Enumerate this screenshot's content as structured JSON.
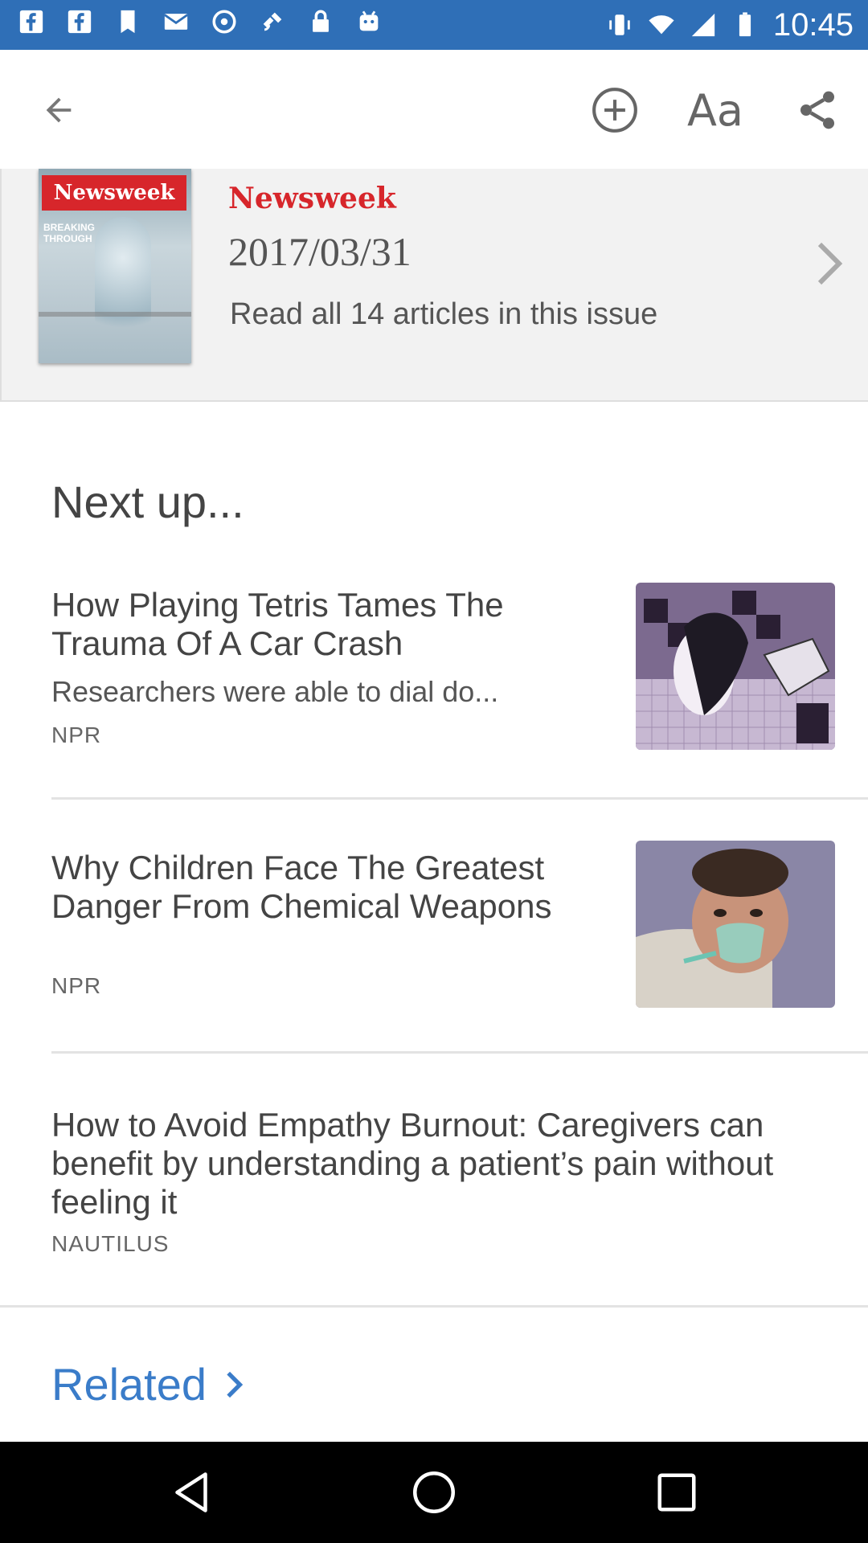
{
  "status_bar": {
    "time": "10:45",
    "notification_icons": [
      "facebook-icon",
      "facebook-icon",
      "bookmark-icon",
      "mail-icon",
      "wifi-icon",
      "satellite-icon",
      "lock-icon",
      "android-icon"
    ],
    "background": "#2f6fb7"
  },
  "app_bar": {
    "back_icon": "arrow-back-icon",
    "add_icon": "add-circle-icon",
    "font_label": "Aa",
    "share_icon": "share-icon"
  },
  "issue": {
    "publication": "Newsweek",
    "cover_masthead": "Newsweek",
    "cover_text": "BREAKING THROUGH",
    "date": "2017/03/31",
    "read_all": "Read all 14 articles in this issue"
  },
  "next_up": {
    "heading": "Next up...",
    "articles": [
      {
        "title": "How Playing Tetris Tames The Trauma Of A Car Crash",
        "summary": "Researchers were able to dial do...",
        "source": "NPR",
        "thumb": "tetris-illustration"
      },
      {
        "title": "Why Children Face The Greatest Danger From Chemical Weapons",
        "summary": "",
        "source": "NPR",
        "thumb": "child-oxygen-mask-photo"
      },
      {
        "title": "How to Avoid Empathy Burnout: Caregivers can benefit by understanding a patient’s pain without feeling it",
        "summary": "",
        "source": "NAUTILUS",
        "thumb": ""
      }
    ]
  },
  "related": {
    "label": "Related"
  },
  "colors": {
    "accent_blue": "#3a7cc9",
    "newsweek_red": "#d7262b",
    "card_bg": "#f2f2f2"
  }
}
